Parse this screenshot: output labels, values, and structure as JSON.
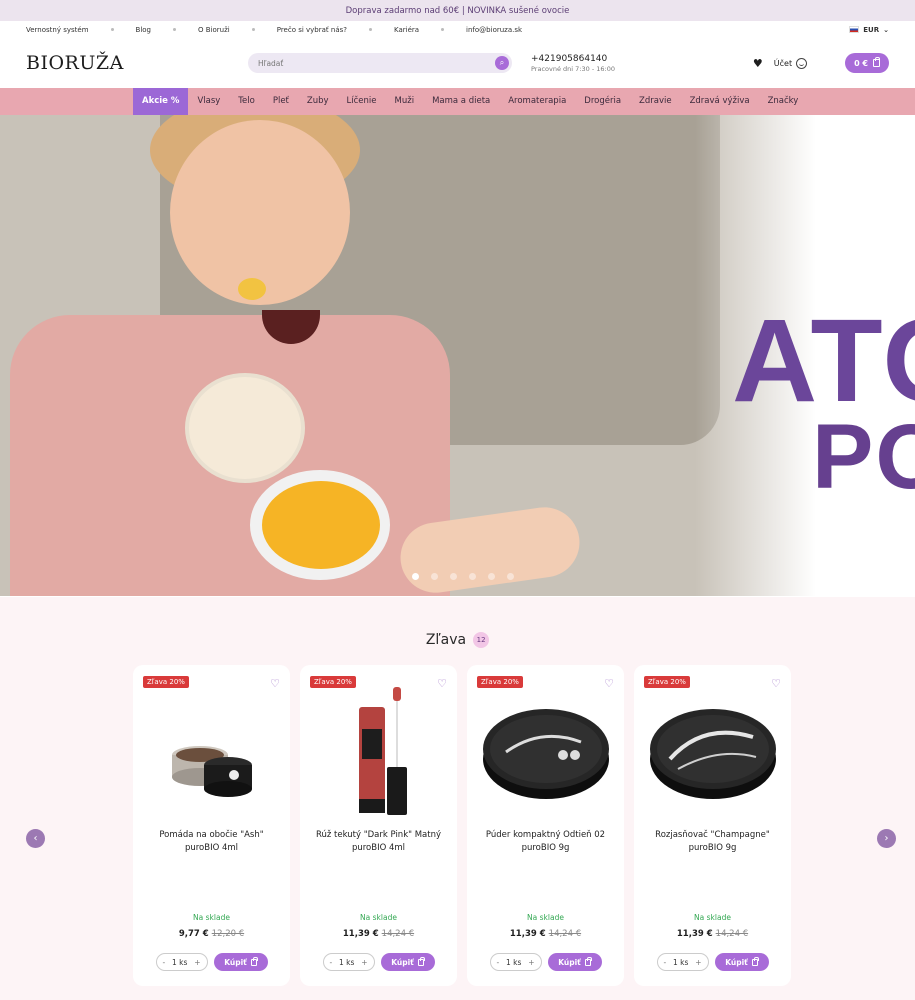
{
  "promo": {
    "text": "Doprava zadarmo nad 60€ | NOVINKA sušené ovocie"
  },
  "top_links": [
    "Vernostný systém",
    "Blog",
    "O Bioruži",
    "Prečo si vybrať nás?",
    "Kariéra",
    "info@bioruza.sk"
  ],
  "currency": "EUR",
  "header": {
    "logo": "BIORUŽA",
    "search_placeholder": "Hľadať",
    "phone": "+421905864140",
    "hours": "Pracovné dni 7:30 - 16:00",
    "account": "Účet",
    "cart": "0 €"
  },
  "nav": [
    "Akcie %",
    "Vlasy",
    "Telo",
    "Pleť",
    "Zuby",
    "Líčenie",
    "Muži",
    "Mama a dieta",
    "Aromaterapia",
    "Drogéria",
    "Zdravie",
    "Zdravá výživa",
    "Značky"
  ],
  "hero": {
    "line1": "ATO",
    "line2": "PO",
    "slides": 6,
    "active_slide": 1
  },
  "discount": {
    "title": "Zľava",
    "count": "12",
    "products": [
      {
        "badge": "Zľava 20%",
        "name": "Pomáda na obočie \"Ash\" puroBIO 4ml",
        "stock": "Na sklade",
        "price": "9,77 €",
        "old_price": "12,20 €",
        "qty": "1 ks",
        "buy": "Kúpiť"
      },
      {
        "badge": "Zľava 20%",
        "name": "Rúž tekutý \"Dark Pink\" Matný puroBIO 4ml",
        "stock": "Na sklade",
        "price": "11,39 €",
        "old_price": "14,24 €",
        "qty": "1 ks",
        "buy": "Kúpiť"
      },
      {
        "badge": "Zľava 20%",
        "name": "Púder kompaktný Odtieň 02 puroBIO 9g",
        "stock": "Na sklade",
        "price": "11,39 €",
        "old_price": "14,24 €",
        "qty": "1 ks",
        "buy": "Kúpiť"
      },
      {
        "badge": "Zľava 20%",
        "name": "Rozjasňovač \"Champagne\" puroBIO 9g",
        "stock": "Na sklade",
        "price": "11,39 €",
        "old_price": "14,24 €",
        "qty": "1 ks",
        "buy": "Kúpiť"
      }
    ]
  },
  "colors": {
    "accent": "#a86bd8",
    "nav_bg": "#e8a7b0",
    "nav_active": "#9c68d6",
    "hero_text": "#6b469a",
    "sale_badge": "#d93a3a",
    "in_stock": "#34a853"
  }
}
